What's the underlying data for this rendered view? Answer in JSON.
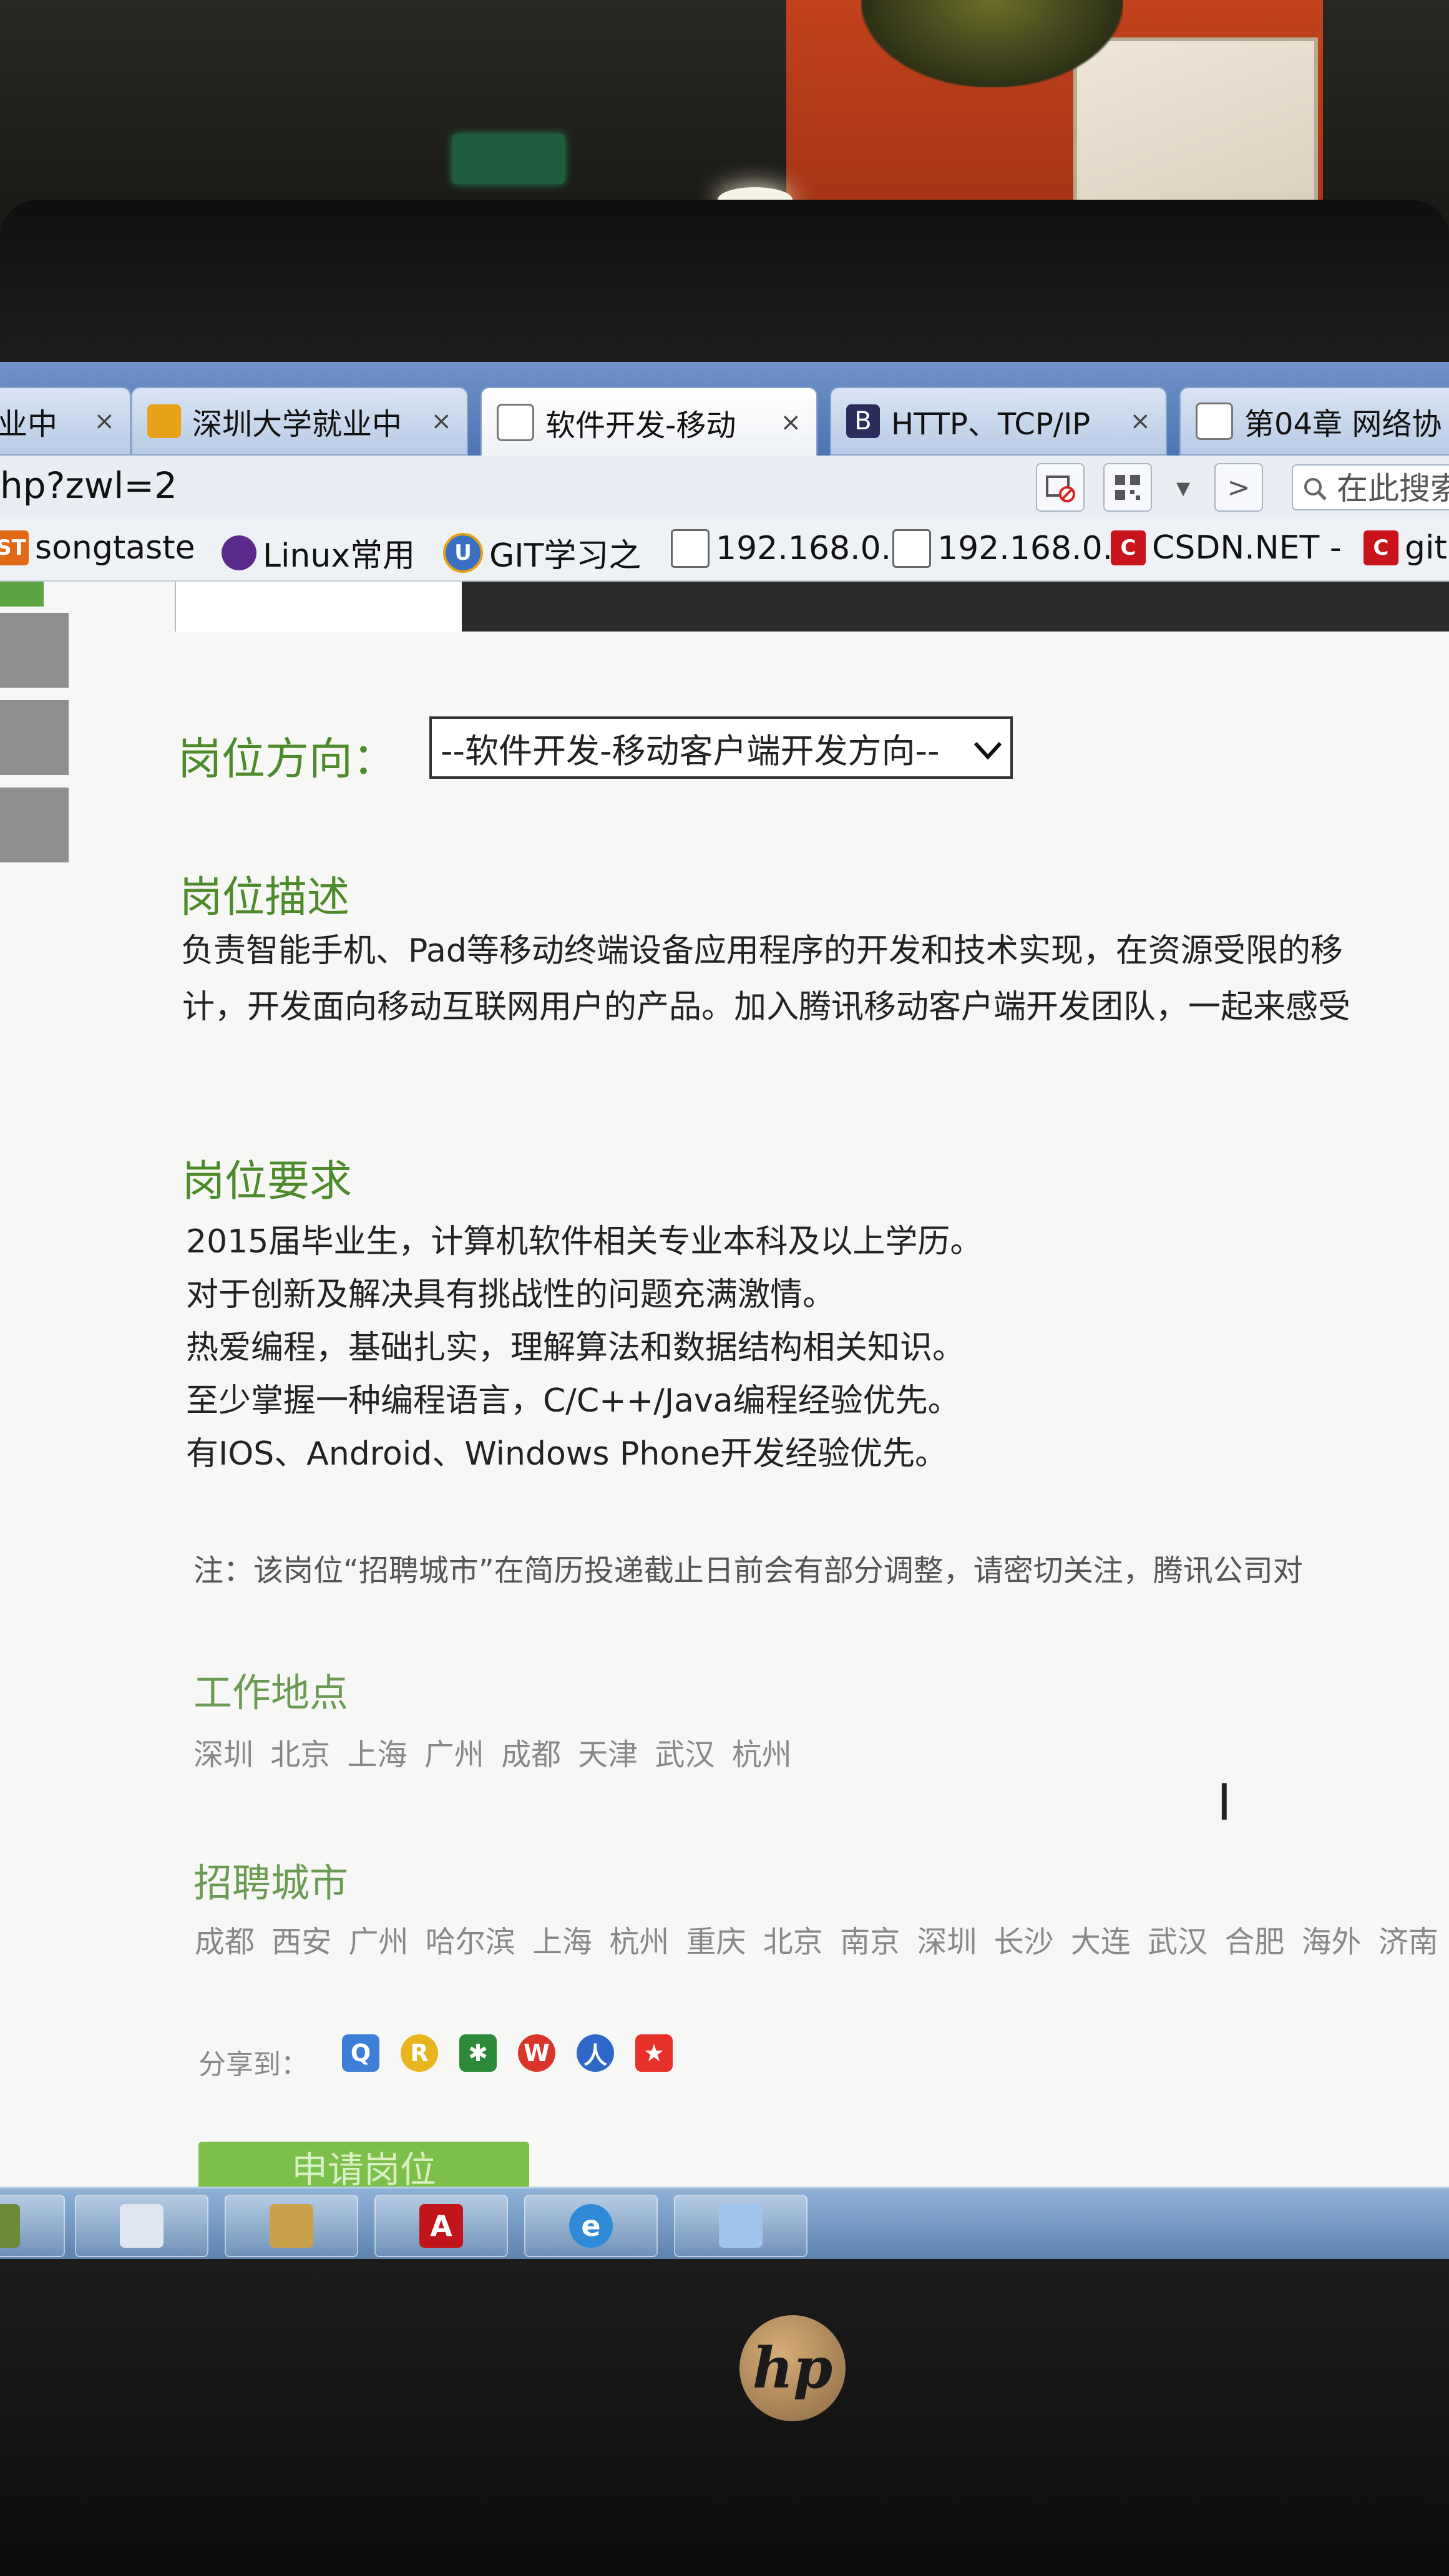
{
  "browser": {
    "tabs": [
      {
        "label": "业中",
        "active": false
      },
      {
        "label": "深圳大学就业中",
        "active": false
      },
      {
        "label": "软件开发-移动",
        "active": true
      },
      {
        "label": "HTTP、TCP/IP",
        "active": false
      },
      {
        "label": "第04章 网络协",
        "active": false
      }
    ],
    "tab_close": "×",
    "url": "hp?zwl=2",
    "search_placeholder": "在此搜索",
    "forward_glyph": ">",
    "dropdown_glyph": "▾"
  },
  "bookmarks": [
    {
      "label": "songtaste",
      "icon": "ST"
    },
    {
      "label": "Linux常用",
      "icon": ""
    },
    {
      "label": "GIT学习之",
      "icon": "U"
    },
    {
      "label": "192.168.0.",
      "icon": ""
    },
    {
      "label": "192.168.0.",
      "icon": ""
    },
    {
      "label": "CSDN.NET -",
      "icon": "C"
    },
    {
      "label": "git",
      "icon": "C"
    }
  ],
  "job": {
    "direction_label": "岗位方向：",
    "direction_value": "--软件开发-移动客户端开发方向--",
    "description_title": "岗位描述",
    "description_lines": [
      "负责智能手机、Pad等移动终端设备应用程序的开发和技术实现，在资源受限的移",
      "计，开发面向移动互联网用户的产品。加入腾讯移动客户端开发团队，一起来感受"
    ],
    "requirements_title": "岗位要求",
    "requirements": [
      "2015届毕业生，计算机软件相关专业本科及以上学历。",
      "对于创新及解决具有挑战性的问题充满激情。",
      "热爱编程，基础扎实，理解算法和数据结构相关知识。",
      "至少掌握一种编程语言，C/C++/Java编程经验优先。",
      "有IOS、Android、Windows Phone开发经验优先。"
    ],
    "note": "注：该岗位“招聘城市”在简历投递截止日前会有部分调整，请密切关注，腾讯公司对",
    "work_location_title": "工作地点",
    "work_locations": "深圳 北京 上海 广州 成都 天津 武汉 杭州",
    "recruit_city_title": "招聘城市",
    "recruit_cities": "成都 西安 广州 哈尔滨 上海 杭州 重庆 北京 南京 深圳 长沙 大连 武汉 合肥 海外 济南 长",
    "share_label": "分享到：",
    "apply_label": "申请岗位"
  },
  "taskbar": {
    "apps": [
      "file-manager",
      "document-viewer",
      "file-browser",
      "pdf-reader",
      "ie-browser",
      "windows-explorer"
    ]
  },
  "monitor_brand": "hp",
  "colors": {
    "heading_green": "#4c8a2a",
    "apply_green": "#7cbf4a",
    "tab_blue": "#4d75b2",
    "csdn_red": "#c8141a"
  }
}
